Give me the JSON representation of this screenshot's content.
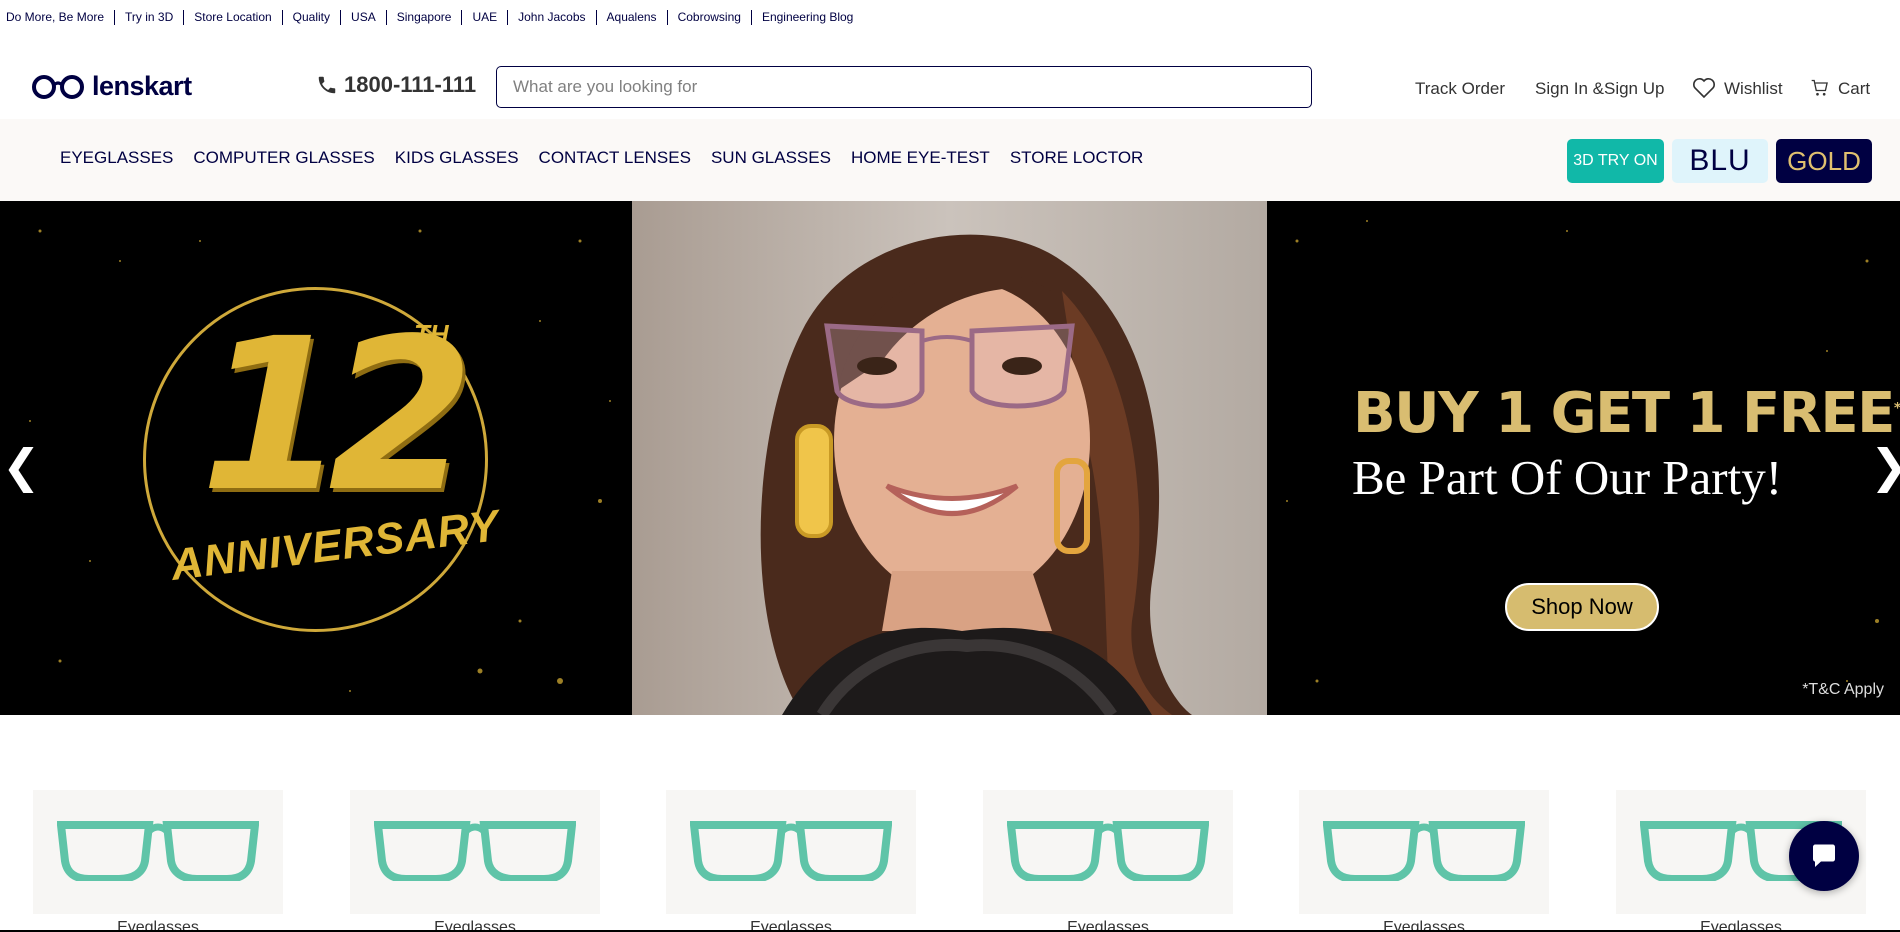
{
  "topbar": {
    "links": [
      "Do More, Be More",
      "Try in 3D",
      "Store Location",
      "Quality",
      "USA",
      "Singapore",
      "UAE",
      "John Jacobs",
      "Aqualens",
      "Cobrowsing",
      "Engineering Blog"
    ]
  },
  "header": {
    "logo_text": "lenskart",
    "phone": "1800-111-111",
    "search_placeholder": "What are you looking for",
    "track_order": "Track Order",
    "sign_in": "Sign In &Sign Up",
    "wishlist": "Wishlist",
    "cart": "Cart"
  },
  "nav": {
    "items": [
      "EYEGLASSES",
      "COMPUTER GLASSES",
      "KIDS GLASSES",
      "CONTACT LENSES",
      "SUN GLASSES",
      "HOME EYE-TEST",
      "STORE LOCTOR"
    ],
    "pill_3d": "3D TRY ON",
    "pill_blu": "BLU",
    "pill_gold": "GOLD"
  },
  "banner": {
    "anniversary_number": "12",
    "anniversary_suffix": "TH",
    "anniversary_word": "ANNIVERSARY",
    "offer": "BUY 1 GET 1 FREE",
    "offer_mark": "*",
    "tagline": "Be Part Of Our Party!",
    "cta": "Shop Now",
    "terms": "*T&C Apply",
    "prev_arrow": "❮",
    "next_arrow": "❯"
  },
  "products": [
    {
      "label": "Eyeglasses"
    },
    {
      "label": "Eyeglasses"
    },
    {
      "label": "Eyeglasses"
    },
    {
      "label": "Eyeglasses"
    },
    {
      "label": "Eyeglasses"
    },
    {
      "label": "Eyeglasses"
    }
  ],
  "colors": {
    "brand_navy": "#000042",
    "teal": "#11b8a8",
    "gold": "#d9bd71",
    "frame_green": "#5fc4a8"
  }
}
